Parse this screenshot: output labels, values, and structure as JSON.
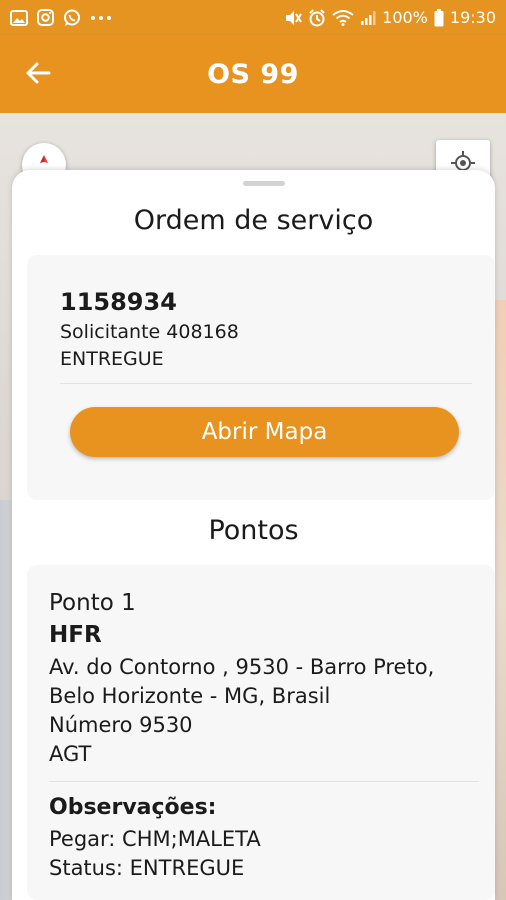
{
  "status_bar": {
    "battery_percent": "100%",
    "time": "19:30",
    "left_icons": [
      "image-icon",
      "instagram-icon",
      "whatsapp-icon",
      "more-icon"
    ],
    "right_icons": [
      "mute-icon",
      "alarm-icon",
      "wifi-icon",
      "signal-icon",
      "battery-icon"
    ]
  },
  "app_bar": {
    "title": "OS 99",
    "back_icon": "arrow-left-icon",
    "color": "#e8931f"
  },
  "sheet": {
    "title": "Ordem de serviço",
    "order": {
      "number": "1158934",
      "requester": "Solicitante 408168",
      "status": "ENTREGUE"
    },
    "open_map_button": "Abrir Mapa",
    "points_title": "Pontos",
    "point": {
      "title": "Ponto 1",
      "name": "HFR",
      "address_line1": "Av. do Contorno , 9530 - Barro Preto,",
      "address_line2": "Belo Horizonte - MG, Brasil",
      "number": "Número 9530",
      "code": "AGT",
      "observations_label": "Observações:",
      "pickup": "Pegar: CHM;MALETA",
      "status": "Status: ENTREGUE"
    }
  }
}
